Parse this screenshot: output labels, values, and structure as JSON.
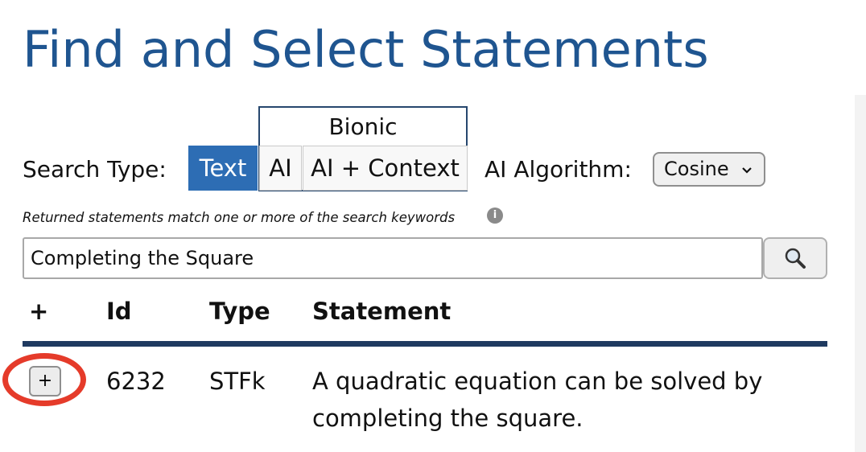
{
  "page": {
    "title": "Find and Select Statements"
  },
  "search_type": {
    "label": "Search Type:",
    "group_label": "Bionic",
    "options": [
      {
        "label": "Text",
        "active": true
      },
      {
        "label": "AI",
        "active": false
      },
      {
        "label": "AI + Context",
        "active": false
      }
    ]
  },
  "algorithm": {
    "label": "AI Algorithm:",
    "selected": "Cosine",
    "icon": "chevron-down-icon"
  },
  "hint": {
    "text": "Returned statements match one or more of the search keywords",
    "icon": "info-icon",
    "glyph": "i"
  },
  "search": {
    "value": "Completing the Square",
    "button_icon": "magnifier-icon"
  },
  "table": {
    "headers": {
      "add": "+",
      "id": "Id",
      "type": "Type",
      "statement": "Statement"
    },
    "rows": [
      {
        "add_label": "+",
        "id": "6232",
        "type": "STFk",
        "statement": "A quadratic equation can be solved by completing the square."
      }
    ]
  },
  "colors": {
    "title": "#1f5590",
    "active_button": "#2d6db4",
    "header_rule": "#1f3a60",
    "highlight": "#e53b2a"
  }
}
